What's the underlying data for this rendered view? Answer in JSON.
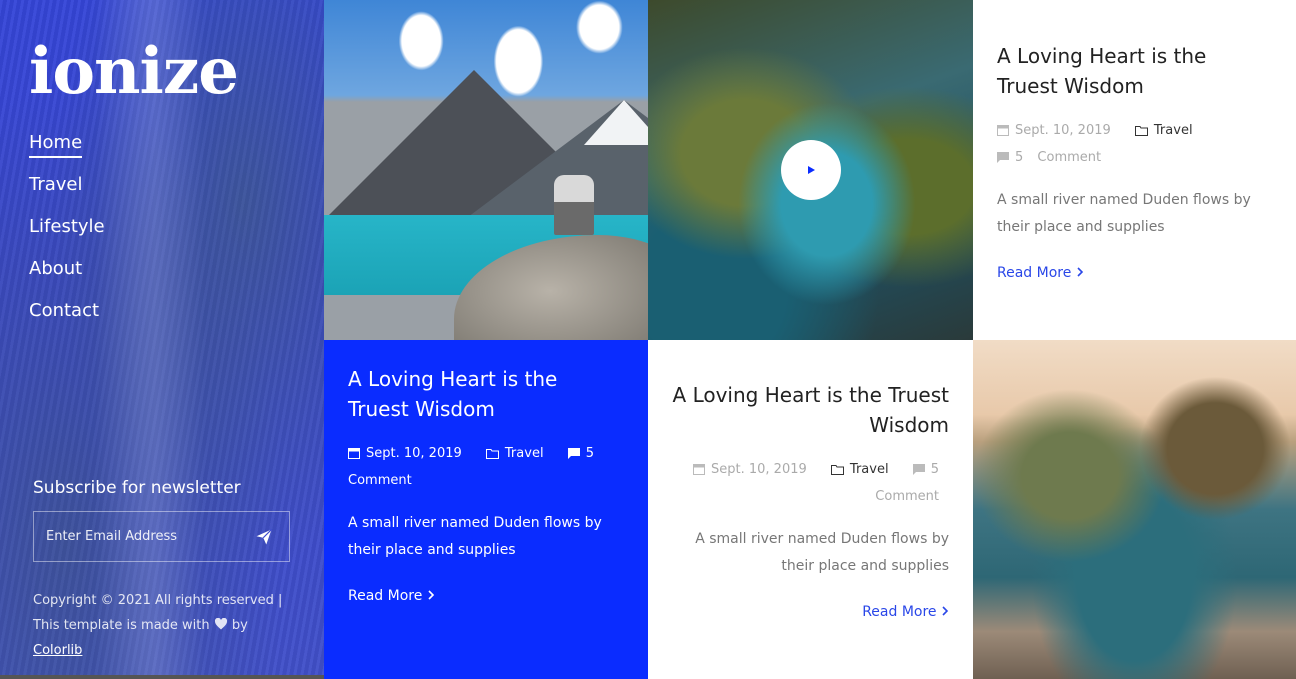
{
  "brand": {
    "logo": "ionize"
  },
  "nav": {
    "items": [
      {
        "label": "Home",
        "active": true
      },
      {
        "label": "Travel",
        "active": false
      },
      {
        "label": "Lifestyle",
        "active": false
      },
      {
        "label": "About",
        "active": false
      },
      {
        "label": "Contact",
        "active": false
      }
    ]
  },
  "newsletter": {
    "title": "Subscribe for newsletter",
    "placeholder": "Enter Email Address",
    "send_icon": "paper-plane-icon"
  },
  "footer": {
    "copyright_line1": "Copyright © 2021 All rights reserved |",
    "copyright_line2": "This template is made with",
    "copyright_by": "by",
    "author": "Colorlib",
    "heart_icon": "heart-icon"
  },
  "posts": [
    {
      "title": "A Loving Heart is the Truest Wisdom",
      "date": "Sept. 10, 2019",
      "category": "Travel",
      "comments": "5",
      "comments_label": "Comment",
      "excerpt": "A small river named Duden flows by their place and supplies",
      "read_more": "Read More"
    },
    {
      "title": "A Loving Heart is the Truest Wisdom",
      "date": "Sept. 10, 2019",
      "category": "Travel",
      "comments": "5",
      "comments_label": "Comment",
      "excerpt": "A small river named Duden flows by their place and supplies",
      "read_more": "Read More"
    },
    {
      "title": "A Loving Heart is the Truest Wisdom",
      "date": "Sept. 10, 2019",
      "category": "Travel",
      "comments": "5",
      "comments_label": "Comment",
      "excerpt": "A small river named Duden flows by their place and supplies",
      "read_more": "Read More"
    }
  ],
  "colors": {
    "accent_blue": "#0a2cff",
    "link_blue": "#2a47e8",
    "sidebar_overlay": "#3546d8"
  },
  "icons": {
    "calendar": "calendar-icon",
    "folder": "folder-icon",
    "comment": "comment-icon",
    "chevron": "chevron-right-icon",
    "play": "play-icon"
  }
}
